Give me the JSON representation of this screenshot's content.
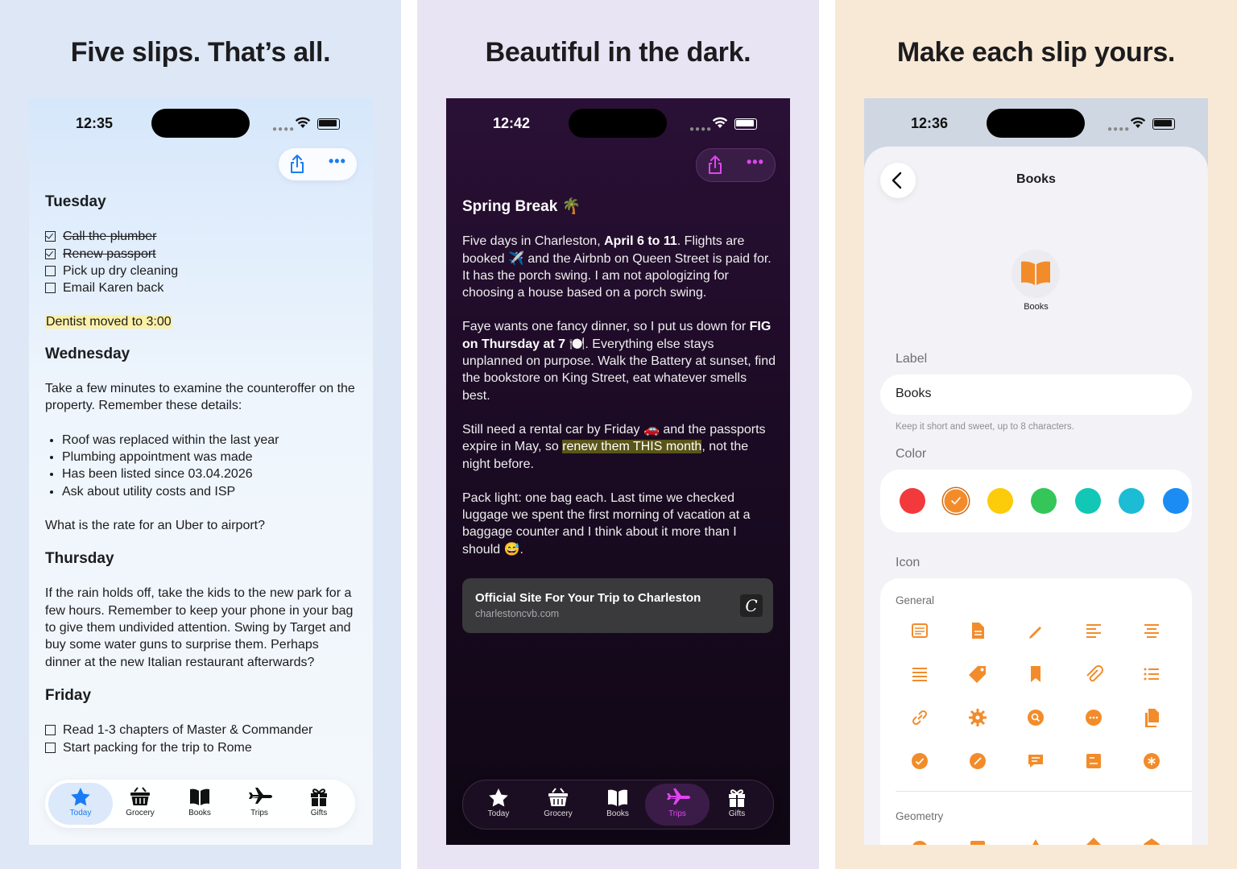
{
  "panels": {
    "left": {
      "headline": "Five slips. That’s all.",
      "time": "12:35",
      "note": {
        "tuesday": "Tuesday",
        "todos1": [
          {
            "text": "Call the plumber",
            "done": true
          },
          {
            "text": "Renew passport",
            "done": true
          },
          {
            "text": "Pick up dry cleaning",
            "done": false
          },
          {
            "text": "Email Karen back",
            "done": false
          }
        ],
        "highlight": "Dentist moved to 3:00",
        "wednesday": "Wednesday",
        "wed_para": "Take a few minutes to examine the counteroffer on the property. Remember these details:",
        "bullets": [
          "Roof was replaced within the last year",
          "Plumbing appointment was made",
          "Has been listed since 03.04.2026",
          "Ask about utility costs and ISP"
        ],
        "question": "What is the rate for an Uber to airport?",
        "thursday": "Thursday",
        "thu_para": "If the rain holds off, take the kids to the new park for a few hours. Remember to keep your phone in your bag to give them undivided attention. Swing by Target and buy some water guns to surprise them. Perhaps dinner at the new Italian restaurant afterwards?",
        "friday": "Friday",
        "todos2": [
          {
            "text": "Read 1-3 chapters of Master & Commander",
            "done": false
          },
          {
            "text": "Start packing for the trip to Rome",
            "done": false
          }
        ]
      },
      "tabs": [
        {
          "label": "Today",
          "icon": "star-icon"
        },
        {
          "label": "Grocery",
          "icon": "basket-icon"
        },
        {
          "label": "Books",
          "icon": "book-icon"
        },
        {
          "label": "Trips",
          "icon": "airplane-icon"
        },
        {
          "label": "Gifts",
          "icon": "gift-icon"
        }
      ],
      "selected_tab": "Today",
      "accent": "#1a7cf4"
    },
    "middle": {
      "headline": "Beautiful in the dark.",
      "time": "12:42",
      "note": {
        "title": "Spring Break 🌴",
        "p1_a": "Five days in Charleston, ",
        "p1_b": "April 6 to 11",
        "p1_c": ". Flights are booked ✈️ and the Airbnb on Queen Street is paid for. It has the porch swing. I am not apologizing for choosing a house based on a porch swing.",
        "p2_a": "Faye wants one fancy dinner, so I put us down for ",
        "p2_b": "FIG on Thursday at 7",
        "p2_c": " 🍽️. Everything else stays unplanned on purpose. Walk the Battery at sunset, find the bookstore on King Street, eat whatever smells best.",
        "p3_a": "Still need a rental car by Friday 🚗 and the passports expire in May, so ",
        "p3_b": "renew them THIS month",
        "p3_c": ", not the night before.",
        "p4": "Pack light: one bag each. Last time we checked luggage we spent the first morning of vacation at a baggage counter and I think about it more than I should 😅."
      },
      "link": {
        "title": "Official Site For Your Trip to Charleston",
        "url": "charlestoncvb.com",
        "logo": "C"
      },
      "tabs": [
        {
          "label": "Today",
          "icon": "star-icon"
        },
        {
          "label": "Grocery",
          "icon": "basket-icon"
        },
        {
          "label": "Books",
          "icon": "book-icon"
        },
        {
          "label": "Trips",
          "icon": "airplane-icon"
        },
        {
          "label": "Gifts",
          "icon": "gift-icon"
        }
      ],
      "selected_tab": "Trips",
      "accent": "#e045f0"
    },
    "right": {
      "headline": "Make each slip yours.",
      "time": "12:36",
      "sheet_title": "Books",
      "preview_label": "Books",
      "label_section": "Label",
      "label_value": "Books",
      "label_hint": "Keep it short and sweet, up to 8 characters.",
      "color_section": "Color",
      "colors": [
        "#f23a3c",
        "#f28c2a",
        "#fccb0a",
        "#34c659",
        "#12c7b5",
        "#1cbcd4",
        "#1a8cf4"
      ],
      "selected_color": "#f28c2a",
      "icon_section": "Icon",
      "general_heading": "General",
      "geometry_heading": "Geometry",
      "icons": [
        "note-icon",
        "document-icon",
        "pencil-icon",
        "align-left-icon",
        "align-center-icon",
        "lines-icon",
        "tag-icon",
        "bookmark-icon",
        "paperclip-icon",
        "list-icon",
        "link-icon",
        "gear-icon",
        "search-icon",
        "ellipsis-icon",
        "copy-icon",
        "checkmark-icon",
        "slash-icon",
        "chat-icon",
        "card-icon",
        "asterisk-icon"
      ],
      "icon_color": "#f28c2a"
    }
  }
}
